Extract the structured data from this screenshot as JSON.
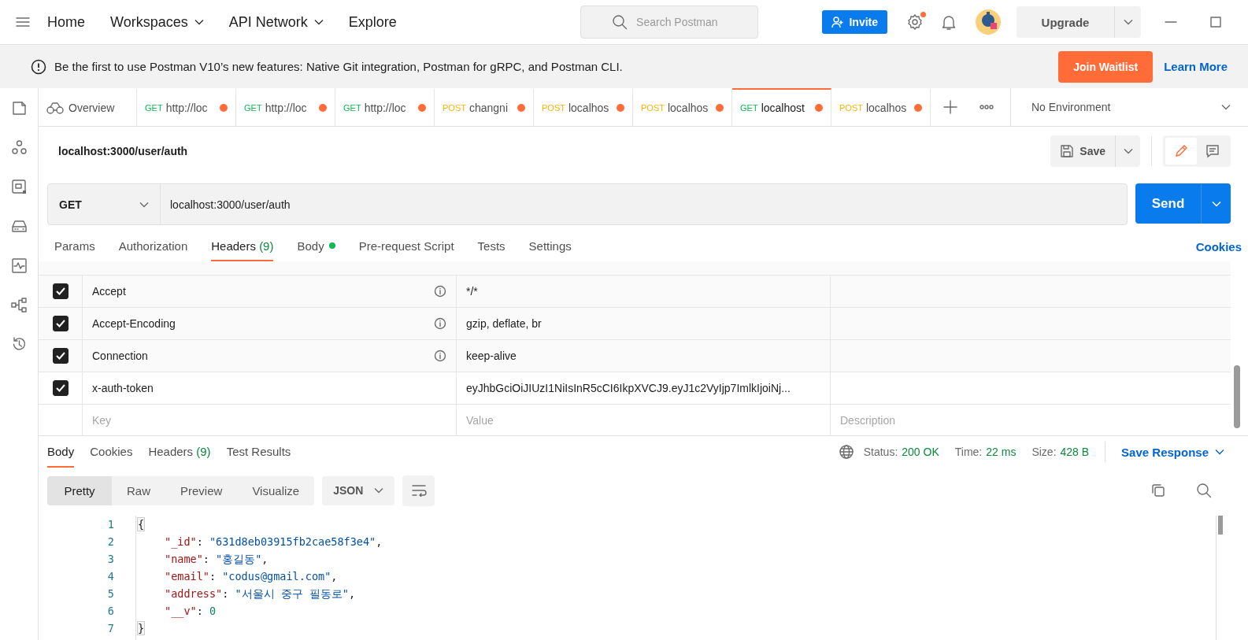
{
  "top_nav": {
    "items": [
      {
        "label": "Home",
        "dropdown": false
      },
      {
        "label": "Workspaces",
        "dropdown": true
      },
      {
        "label": "API Network",
        "dropdown": true
      },
      {
        "label": "Explore",
        "dropdown": false
      }
    ],
    "search": {
      "placeholder": "Search Postman"
    },
    "invite": "Invite",
    "settings_notification": true,
    "upgrade": "Upgrade"
  },
  "banner": {
    "text": "Be the first to use Postman V10’s new features: Native Git integration, Postman for gRPC, and Postman CLI.",
    "primary_button": "Join Waitlist",
    "link": "Learn More"
  },
  "tabs": [
    {
      "kind": "overview",
      "label": "Overview",
      "selected": false,
      "unsaved": false
    },
    {
      "kind": "request",
      "method": "GET",
      "label": "http://loc",
      "selected": false,
      "unsaved": true
    },
    {
      "kind": "request",
      "method": "GET",
      "label": "http://loc",
      "selected": false,
      "unsaved": true
    },
    {
      "kind": "request",
      "method": "GET",
      "label": "http://loc",
      "selected": false,
      "unsaved": true
    },
    {
      "kind": "request",
      "method": "POST",
      "label": "changni",
      "selected": false,
      "unsaved": true
    },
    {
      "kind": "request",
      "method": "POST",
      "label": "localhos",
      "selected": false,
      "unsaved": true
    },
    {
      "kind": "request",
      "method": "POST",
      "label": "localhos",
      "selected": false,
      "unsaved": true
    },
    {
      "kind": "request",
      "method": "GET",
      "label": "localhost",
      "selected": true,
      "unsaved": true
    },
    {
      "kind": "request",
      "method": "POST",
      "label": "localhos",
      "selected": false,
      "unsaved": true
    }
  ],
  "environment": "No Environment",
  "mode_toggle": [
    {
      "kind": "edit",
      "selected": true
    },
    {
      "kind": "comments",
      "selected": false
    }
  ],
  "request": {
    "title": "localhost:3000/user/auth",
    "save": "Save",
    "method": "GET",
    "url": "localhost:3000/user/auth",
    "send": "Send"
  },
  "request_tabs": [
    {
      "label": "Params",
      "selected": false
    },
    {
      "label": "Authorization",
      "selected": false
    },
    {
      "label": "Headers",
      "count": "(9)",
      "selected": true
    },
    {
      "label": "Body",
      "has_content": true,
      "selected": false
    },
    {
      "label": "Pre-request Script",
      "selected": false
    },
    {
      "label": "Tests",
      "selected": false
    },
    {
      "label": "Settings",
      "selected": false
    }
  ],
  "cookies_link": "Cookies",
  "headers": {
    "rows": [
      {
        "checked": true,
        "key": "Accept",
        "value": "*/*",
        "info": true
      },
      {
        "checked": true,
        "key": "Accept-Encoding",
        "value": "gzip, deflate, br",
        "info": true
      },
      {
        "checked": true,
        "key": "Connection",
        "value": "keep-alive",
        "info": true
      },
      {
        "checked": true,
        "key": "x-auth-token",
        "value": "eyJhbGciOiJIUzI1NiIsInR5cCI6IkpXVCJ9.eyJ1c2VyIjp7ImlkIjoiNj...",
        "info": false
      }
    ],
    "new_row": {
      "key_placeholder": "Key",
      "value_placeholder": "Value",
      "description_placeholder": "Description"
    }
  },
  "response_tabs": [
    {
      "label": "Body",
      "selected": true
    },
    {
      "label": "Cookies",
      "selected": false
    },
    {
      "label": "Headers",
      "count": "(9)",
      "selected": false
    },
    {
      "label": "Test Results",
      "selected": false
    }
  ],
  "response_meta": [
    {
      "label": "Status:",
      "value": "200 OK"
    },
    {
      "label": "Time:",
      "value": "22 ms"
    },
    {
      "label": "Size:",
      "value": "428 B"
    }
  ],
  "save_response": "Save Response",
  "view_modes": [
    {
      "label": "Pretty",
      "selected": true
    },
    {
      "label": "Raw",
      "selected": false
    },
    {
      "label": "Preview",
      "selected": false
    },
    {
      "label": "Visualize",
      "selected": false
    }
  ],
  "format": "JSON",
  "code_lines": [
    {
      "number": "1",
      "kind": "brace",
      "tokens": [
        {
          "kind": "punct",
          "text": "{"
        }
      ]
    },
    {
      "number": "2",
      "kind": "member",
      "tokens": [
        {
          "kind": "key",
          "text": "\"_id\""
        },
        {
          "kind": "punct",
          "text": ": "
        },
        {
          "kind": "string",
          "text": "\"631d8eb03915fb2cae58f3e4\""
        },
        {
          "kind": "punct",
          "text": ","
        }
      ]
    },
    {
      "number": "3",
      "kind": "member",
      "tokens": [
        {
          "kind": "key",
          "text": "\"name\""
        },
        {
          "kind": "punct",
          "text": ": "
        },
        {
          "kind": "string",
          "text": "\"홍길동\""
        },
        {
          "kind": "punct",
          "text": ","
        }
      ]
    },
    {
      "number": "4",
      "kind": "member",
      "tokens": [
        {
          "kind": "key",
          "text": "\"email\""
        },
        {
          "kind": "punct",
          "text": ": "
        },
        {
          "kind": "string",
          "text": "\"codus@gmail.com\""
        },
        {
          "kind": "punct",
          "text": ","
        }
      ]
    },
    {
      "number": "5",
      "kind": "member",
      "tokens": [
        {
          "kind": "key",
          "text": "\"address\""
        },
        {
          "kind": "punct",
          "text": ": "
        },
        {
          "kind": "string",
          "text": "\"서울시 중구 필동로\""
        },
        {
          "kind": "punct",
          "text": ","
        }
      ]
    },
    {
      "number": "6",
      "kind": "member",
      "tokens": [
        {
          "kind": "key",
          "text": "\"__v\""
        },
        {
          "kind": "punct",
          "text": ": "
        },
        {
          "kind": "number",
          "text": "0"
        }
      ]
    },
    {
      "number": "7",
      "kind": "brace",
      "tokens": [
        {
          "kind": "punct",
          "text": "}"
        }
      ]
    }
  ]
}
